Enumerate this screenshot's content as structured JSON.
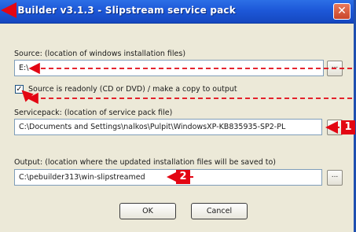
{
  "window": {
    "title": "t Builder v3.1.3 - Slipstream service pack",
    "close_glyph": "✕"
  },
  "source": {
    "label": "Source: (location of windows installation files)",
    "value": "E:\\",
    "browse_label": "..."
  },
  "readonly": {
    "checked": true,
    "check_glyph": "✓",
    "label": "Source is readonly (CD or DVD) / make a copy to output"
  },
  "servicepack": {
    "label": "Servicepack: (location of service pack file)",
    "value": "C:\\Documents and Settings\\nalkos\\Pulpit\\WindowsXP-KB835935-SP2-PL",
    "browse_label": "..."
  },
  "output": {
    "label": "Output: (location where the updated installation files will be saved to)",
    "value": "C:\\pebuilder313\\win-slipstreamed",
    "browse_label": "..."
  },
  "buttons": {
    "ok": "OK",
    "cancel": "Cancel"
  },
  "callouts": {
    "badge_1": "1",
    "badge_2": "2",
    "color": "#e30613"
  }
}
